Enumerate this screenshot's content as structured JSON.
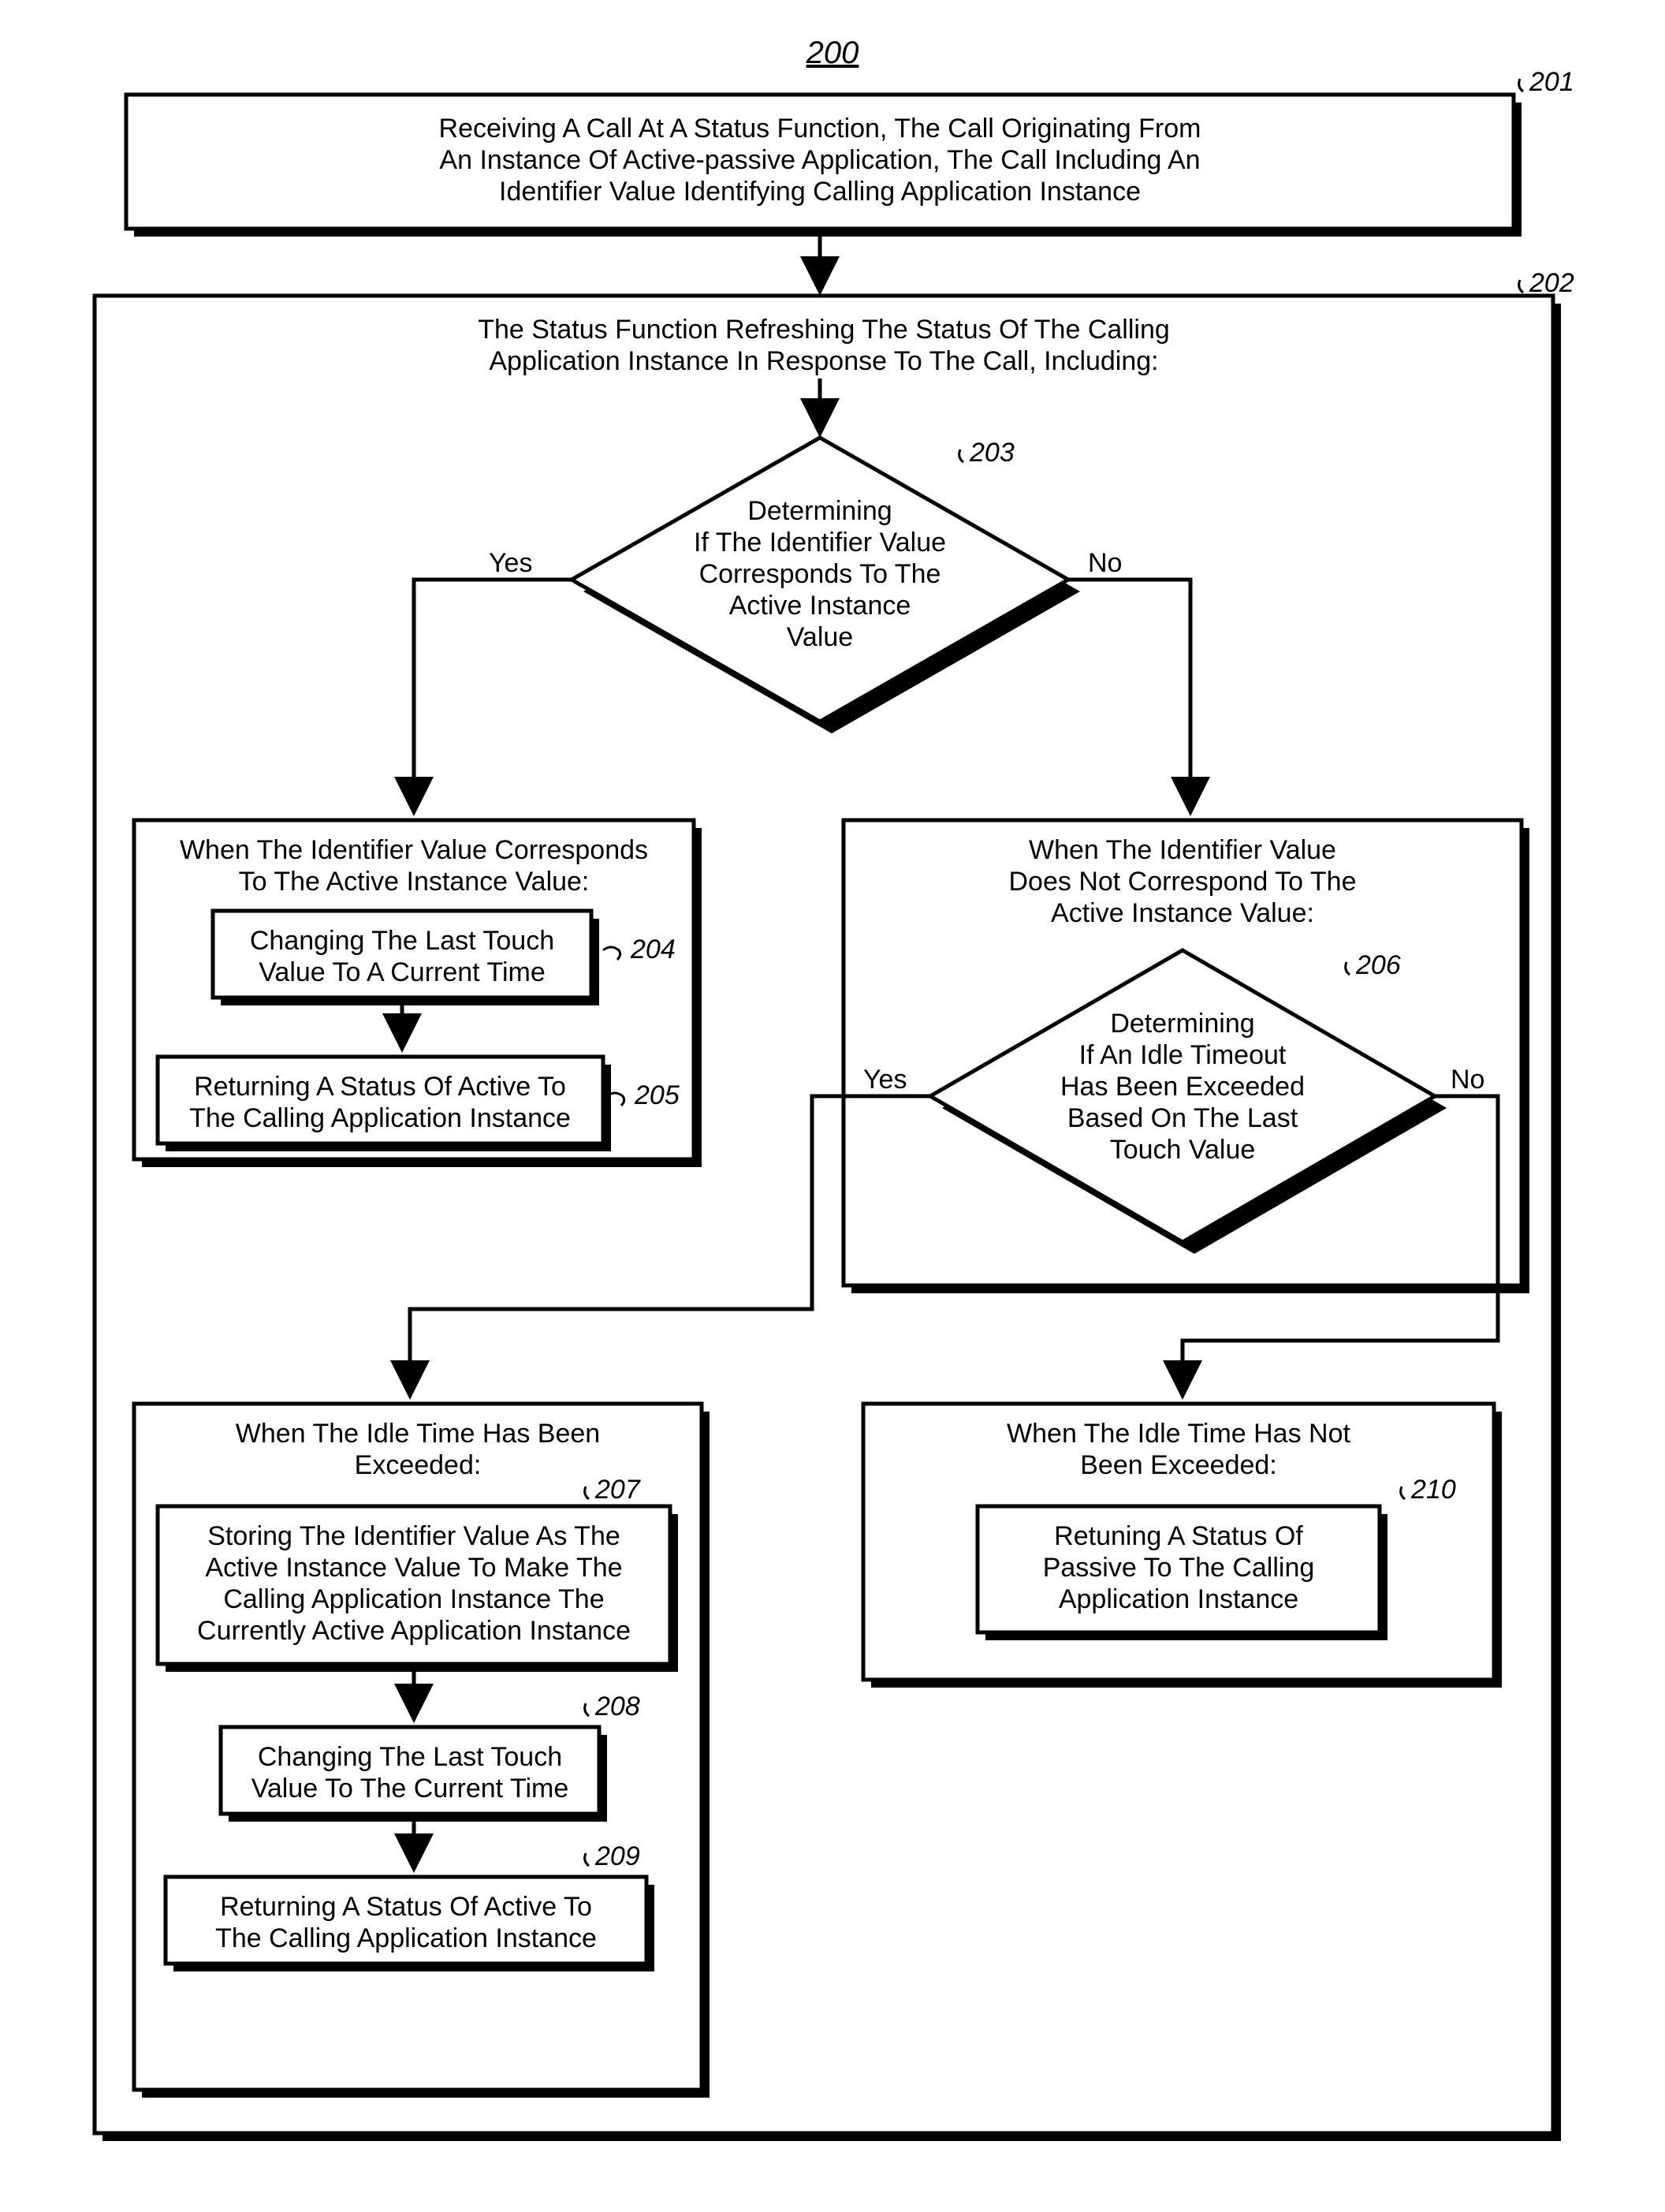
{
  "title": "200",
  "refs": {
    "r201": "201",
    "r202": "202",
    "r203": "203",
    "r204": "204",
    "r205": "205",
    "r206": "206",
    "r207": "207",
    "r208": "208",
    "r209": "209",
    "r210": "210"
  },
  "branch": {
    "yes": "Yes",
    "no": "No"
  },
  "box201": {
    "l1": "Receiving A Call At A Status Function, The Call Originating From",
    "l2": "An Instance Of Active-passive Application, The Call Including An",
    "l3": "Identifier Value Identifying Calling Application Instance"
  },
  "box202": {
    "l1": "The Status Function Refreshing The Status Of The Calling",
    "l2": "Application Instance In Response To The Call, Including:"
  },
  "dec203": {
    "l1": "Determining",
    "l2": "If The Identifier Value",
    "l3": "Corresponds To The",
    "l4": "Active Instance",
    "l5": "Value"
  },
  "boxYes": {
    "l1": "When The Identifier Value Corresponds",
    "l2": "To The Active Instance Value:"
  },
  "box204": {
    "l1": "Changing The Last Touch",
    "l2": "Value To A Current Time"
  },
  "box205": {
    "l1": "Returning A Status Of Active To",
    "l2": "The Calling Application Instance"
  },
  "boxNo": {
    "l1": "When The Identifier Value",
    "l2": "Does Not Correspond To The",
    "l3": "Active Instance Value:"
  },
  "dec206": {
    "l1": "Determining",
    "l2": "If An Idle Timeout",
    "l3": "Has Been Exceeded",
    "l4": "Based On The Last",
    "l5": "Touch Value"
  },
  "boxExc": {
    "l1": "When The Idle Time Has Been",
    "l2": "Exceeded:"
  },
  "box207": {
    "l1": "Storing The Identifier Value As The",
    "l2": "Active Instance Value To Make The",
    "l3": "Calling Application Instance The",
    "l4": "Currently Active Application Instance"
  },
  "box208": {
    "l1": "Changing The Last Touch",
    "l2": "Value To The Current Time"
  },
  "box209": {
    "l1": "Returning A Status Of Active To",
    "l2": "The Calling Application Instance"
  },
  "boxNotExc": {
    "l1": "When The Idle Time Has Not",
    "l2": "Been Exceeded:"
  },
  "box210": {
    "l1": "Retuning A Status Of",
    "l2": "Passive To The Calling",
    "l3": "Application Instance"
  }
}
